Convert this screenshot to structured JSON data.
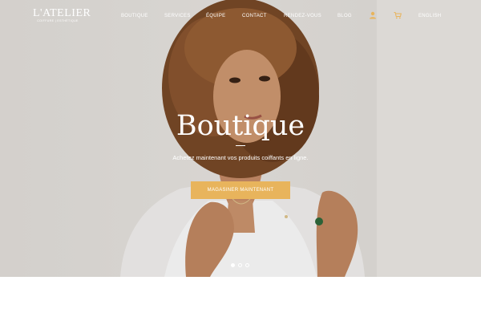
{
  "logo": {
    "word": "L'ATELIER",
    "tagline": "COIFFURE | ESTHÉTIQUE"
  },
  "nav": {
    "items": [
      "Boutique",
      "Services",
      "Équipe",
      "Contact",
      "Rendez-vous",
      "Blog"
    ],
    "account_icon": "user-icon",
    "cart_icon": "cart-icon",
    "language": "English"
  },
  "hero": {
    "title": "Boutique",
    "subtitle": "Achetez maintenant vos produits coiffants en ligne.",
    "cta_label": "Magasiner maintenant",
    "slides": 3,
    "active_slide": 1
  },
  "next_section": {
    "title_fragment": ""
  },
  "colors": {
    "accent": "#e8b45c",
    "text_on_image": "#ffffff"
  }
}
